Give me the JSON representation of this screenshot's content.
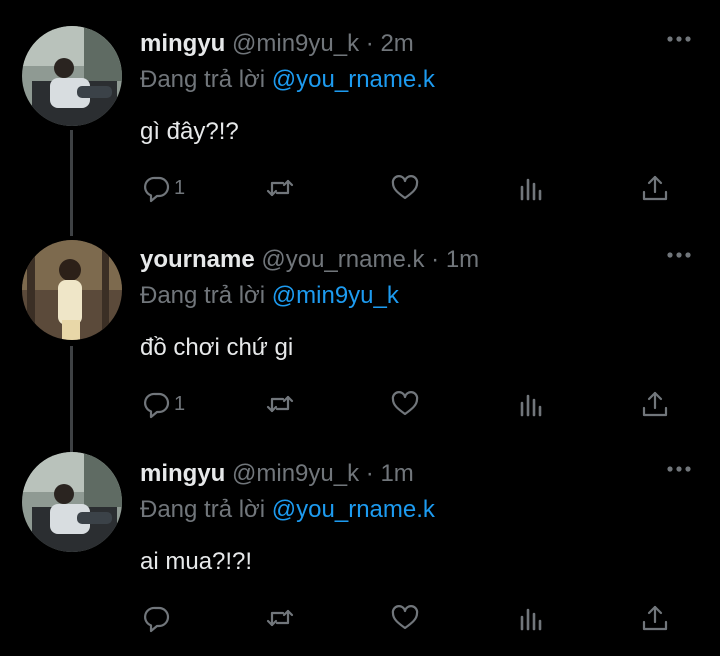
{
  "tweets": [
    {
      "name": "mingyu",
      "handle": "@min9yu_k",
      "time": "2m",
      "replying_label": "Đang trả lời",
      "replying_to": "@you_rname.k",
      "text": "gì đây?!?",
      "reply_count": "1",
      "avatar": "boy-on-sofa-photo"
    },
    {
      "name": "yourname",
      "handle": "@you_rname.k",
      "time": "1m",
      "replying_label": "Đang trả lời",
      "replying_to": "@min9yu_k",
      "text": "đồ chơi chứ gi",
      "reply_count": "1",
      "avatar": "girl-in-forest-photo"
    },
    {
      "name": "mingyu",
      "handle": "@min9yu_k",
      "time": "1m",
      "replying_label": "Đang trả lời",
      "replying_to": "@you_rname.k",
      "text": "ai mua?!?!",
      "reply_count": "",
      "avatar": "boy-on-sofa-photo"
    }
  ],
  "separator": "·",
  "icons": [
    "reply-icon",
    "retweet-icon",
    "like-icon",
    "analytics-icon",
    "share-icon",
    "more-icon"
  ],
  "colors": {
    "background": "#000000",
    "text": "#e7e9ea",
    "muted": "#71767b",
    "link": "#1d9bf0"
  }
}
